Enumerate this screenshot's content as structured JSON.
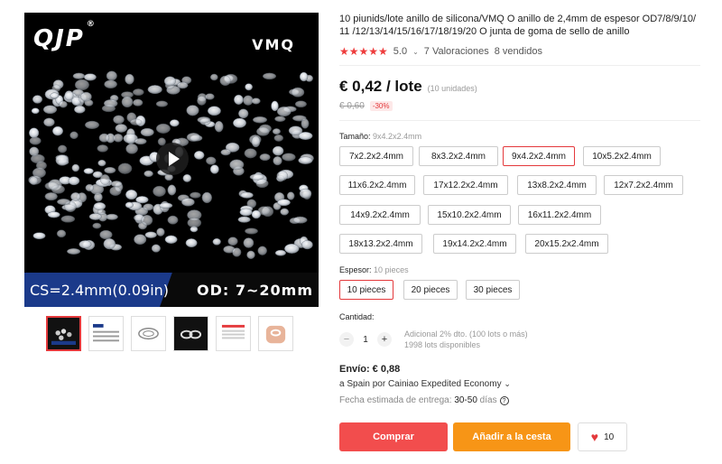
{
  "gallery": {
    "logo": "QJP",
    "logo_mark": "®",
    "material_label": "VMQ",
    "cs_label": "CS=2.4mm(0.09in)",
    "od_label": "OD: 7~20mm",
    "thumbnails": [
      "thumb-1",
      "thumb-2",
      "thumb-3",
      "thumb-4",
      "thumb-5",
      "thumb-6"
    ]
  },
  "product": {
    "title": "10 piunids/lote anillo de silicona/VMQ O anillo de 2,4mm de espesor OD7/8/9/10/ 11 /12/13/14/15/16/17/18/19/20 O junta de goma de sello de anillo",
    "rating": "5.0",
    "reviews": "7 Valoraciones",
    "sold": "8 vendidos",
    "stars": "★★★★★"
  },
  "price": {
    "current": "€ 0,42 / lote",
    "units": "(10 unidades)",
    "old": "€ 0,60",
    "discount": "-30%"
  },
  "size": {
    "label": "Tamaño:",
    "selected": "9x4.2x2.4mm",
    "options": [
      "7x2.2x2.4mm",
      "8x3.2x2.4mm",
      "9x4.2x2.4mm",
      "10x5.2x2.4mm",
      "11x6.2x2.4mm",
      "17x12.2x2.4mm",
      "13x8.2x2.4mm",
      "12x7.2x2.4mm",
      "14x9.2x2.4mm",
      "15x10.2x2.4mm",
      "16x11.2x2.4mm",
      "18x13.2x2.4mm",
      "19x14.2x2.4mm",
      "20x15.2x2.4mm"
    ]
  },
  "thickness": {
    "label": "Espesor:",
    "selected": "10 pieces",
    "options": [
      "10 pieces",
      "20 pieces",
      "30 pieces"
    ]
  },
  "quantity": {
    "label": "Cantidad:",
    "value": "1",
    "minus": "−",
    "plus": "+",
    "discount_note": "Adicional 2% dto. (100 lots o más)",
    "available": "1998 lots disponibles"
  },
  "shipping": {
    "title": "Envío: € 0,88",
    "method_prefix": "a Spain por ",
    "carrier": "Cainiao Expedited Economy",
    "chevron": "⌄",
    "date_label": "Fecha estimada de entrega: ",
    "date_value": "30-50",
    "date_unit": " días",
    "info_icon": "?"
  },
  "actions": {
    "buy": "Comprar",
    "cart": "Añadir a la cesta",
    "wish_count": "10",
    "heart": "♥"
  },
  "colors": {
    "accent": "#e4393c",
    "buy": "#f24d4d",
    "cart": "#f79516",
    "banner_blue": "#1b3a8a"
  }
}
